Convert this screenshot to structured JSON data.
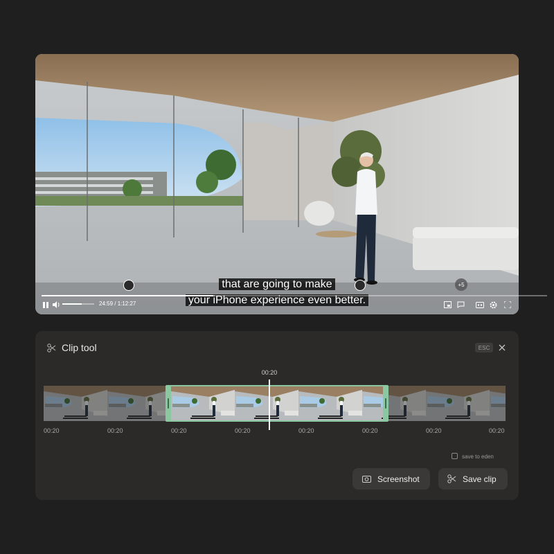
{
  "player": {
    "subtitle_line1": "that are going to make",
    "subtitle_line2": "your iPhone experience even better.",
    "time_display": "24:59 / 1:12:27",
    "progress_fraction": 0.34,
    "volume_fraction": 0.6,
    "more_markers_label": "+5",
    "icons": [
      "pause-icon",
      "volume-icon",
      "pip-icon",
      "comment-icon",
      "captions-icon",
      "settings-icon",
      "fullscreen-icon"
    ]
  },
  "clip_tool": {
    "title": "Clip tool",
    "esc_label": "ESC",
    "playhead_time": "00:20",
    "ticks": [
      "00:20",
      "00:20",
      "00:20",
      "00:20",
      "00:20",
      "00:20",
      "00:20",
      "00:20"
    ],
    "save_to_eden_label": "save to eden",
    "save_to_eden_checked": false,
    "screenshot_label": "Screenshot",
    "save_clip_label": "Save clip"
  },
  "colors": {
    "accent_selection": "#8bc7a0",
    "panel_bg": "#2b2a29",
    "page_bg": "#1f1f1f"
  }
}
